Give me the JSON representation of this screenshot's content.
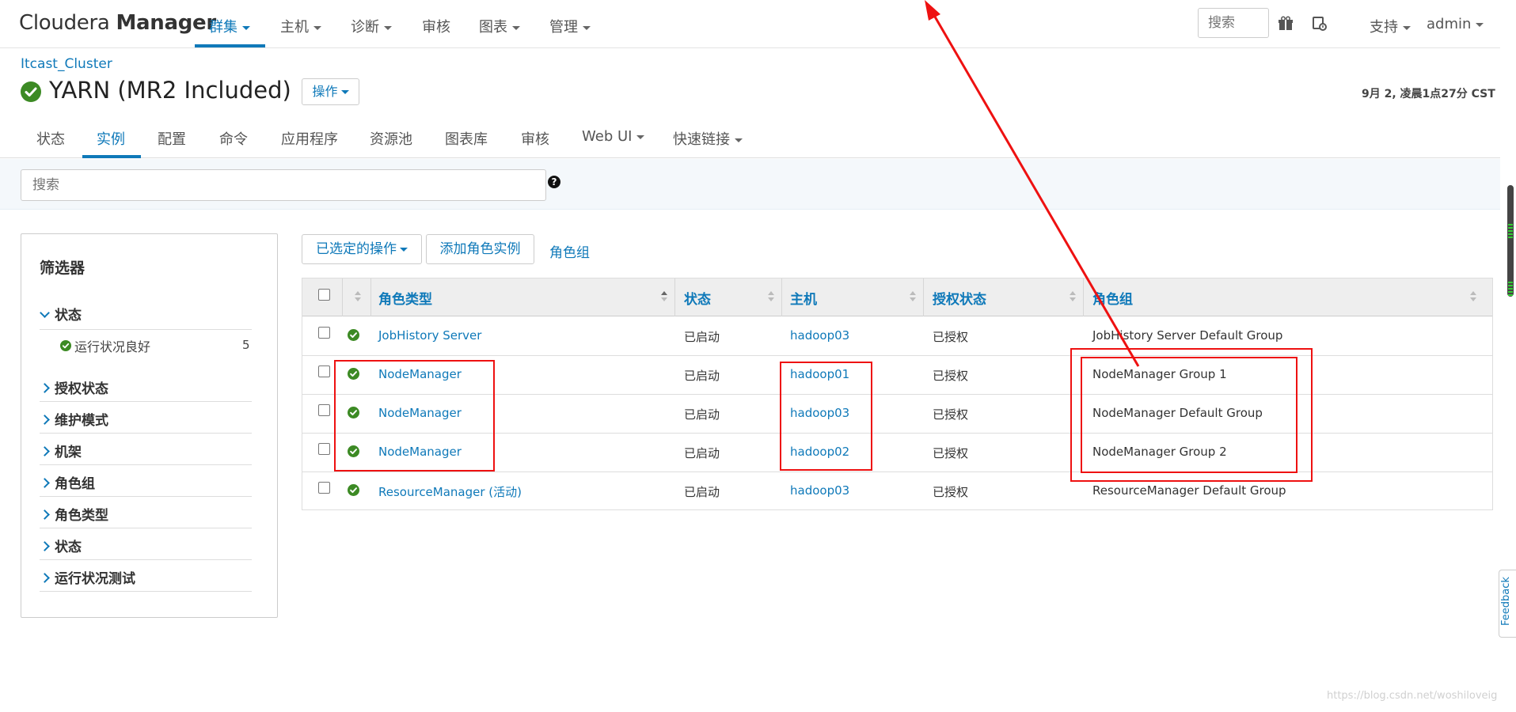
{
  "brand": {
    "name_light": "Cloudera ",
    "name_bold": "Manager"
  },
  "topnav": {
    "items": [
      {
        "label": "群集",
        "dropdown": true,
        "active": true
      },
      {
        "label": "主机",
        "dropdown": true
      },
      {
        "label": "诊断",
        "dropdown": true
      },
      {
        "label": "审核",
        "dropdown": false
      },
      {
        "label": "图表",
        "dropdown": true
      },
      {
        "label": "管理",
        "dropdown": true
      }
    ],
    "search_placeholder": "搜索",
    "support_label": "支持",
    "user_label": "admin"
  },
  "header": {
    "breadcrumb": "Itcast_Cluster",
    "title": "YARN (MR2 Included)",
    "actions_label": "操作",
    "timestamp": "9月 2, 凌晨1点27分 CST"
  },
  "subtabs": [
    "状态",
    "实例",
    "配置",
    "命令",
    "应用程序",
    "资源池",
    "图表库",
    "审核",
    "Web UI",
    "快速链接"
  ],
  "search": {
    "placeholder": "搜索"
  },
  "filter": {
    "title": "筛选器",
    "status_section": "状态",
    "status_sub": {
      "label": "运行状况良好",
      "count": "5"
    },
    "sections": [
      "授权状态",
      "维护模式",
      "机架",
      "角色组",
      "角色类型",
      "状态",
      "运行状况测试"
    ]
  },
  "actions": {
    "selected_ops": "已选定的操作",
    "add_role_instance": "添加角色实例",
    "role_groups": "角色组"
  },
  "table": {
    "headers": [
      "角色类型",
      "状态",
      "主机",
      "授权状态",
      "角色组"
    ],
    "rows": [
      {
        "role_type": "JobHistory Server",
        "status": "已启动",
        "host": "hadoop03",
        "auth": "已授权",
        "group": "JobHistory Server Default Group"
      },
      {
        "role_type": "NodeManager",
        "status": "已启动",
        "host": "hadoop01",
        "auth": "已授权",
        "group": "NodeManager Group 1"
      },
      {
        "role_type": "NodeManager",
        "status": "已启动",
        "host": "hadoop03",
        "auth": "已授权",
        "group": "NodeManager Default Group"
      },
      {
        "role_type": "NodeManager",
        "status": "已启动",
        "host": "hadoop02",
        "auth": "已授权",
        "group": "NodeManager Group 2"
      },
      {
        "role_type": "ResourceManager (活动)",
        "status": "已启动",
        "host": "hadoop03",
        "auth": "已授权",
        "group": "ResourceManager Default Group"
      }
    ]
  },
  "feedback_label": "Feedback",
  "watermark": "https://blog.csdn.net/woshiloveig",
  "colors": {
    "accent": "#0f79b9",
    "ok": "#3c8a24",
    "annotation": "#e11111"
  }
}
